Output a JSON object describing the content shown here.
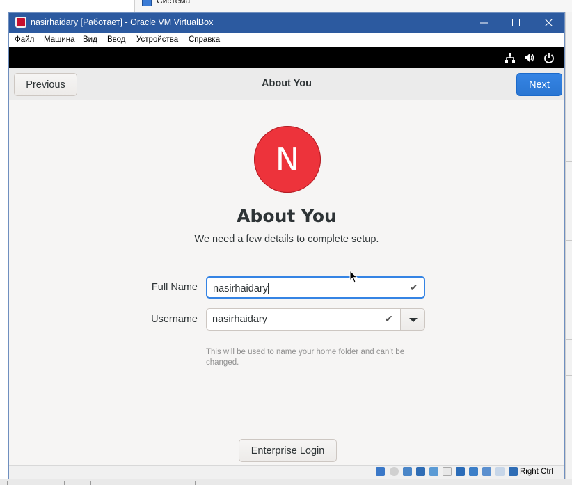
{
  "background": {
    "task_label": "Система"
  },
  "window": {
    "title": "nasirhaidary [Работает] - Oracle VM VirtualBox",
    "controls": {
      "minimize": "—",
      "maximize": "☐",
      "close": "✕"
    }
  },
  "menu": [
    "Файл",
    "Машина",
    "Вид",
    "Ввод",
    "Устройства",
    "Справка"
  ],
  "gnome_topbar": {
    "icons": [
      "network-icon",
      "volume-icon",
      "power-icon"
    ]
  },
  "headerbar": {
    "previous_label": "Previous",
    "title": "About You",
    "next_label": "Next"
  },
  "page": {
    "avatar_initial": "N",
    "title": "About You",
    "subtitle": "We need a few details to complete setup."
  },
  "form": {
    "full_name_label": "Full Name",
    "full_name_value": "nasirhaidary",
    "username_label": "Username",
    "username_value": "nasirhaidary",
    "username_hint": "This will be used to name your home folder and can’t be changed.",
    "check_glyph": "✔"
  },
  "enterprise_login_label": "Enterprise Login",
  "statusbar": {
    "host_key_label": "Right Ctrl",
    "icons": [
      "hard-disk-icon",
      "optical-drive-icon",
      "audio-icon",
      "network-icon",
      "usb-icon",
      "shared-folders-icon",
      "display-icon",
      "video-capture-icon",
      "recording-icon",
      "cpu-icon",
      "mouse-integration-icon",
      "keyboard-capture-icon"
    ]
  },
  "colors": {
    "titlebar": "#2c5aa0",
    "accent": "#3584e4",
    "avatar": "#ed333b"
  }
}
